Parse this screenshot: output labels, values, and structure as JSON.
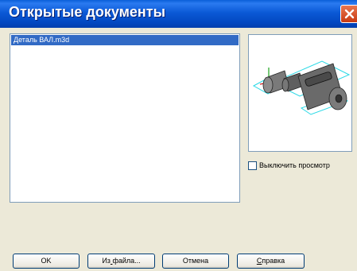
{
  "window": {
    "title": "Открытые документы"
  },
  "documents": {
    "items": [
      {
        "label": "Деталь ВАЛ.m3d",
        "selected": true
      }
    ]
  },
  "preview": {
    "icon": "3d-shaft-part-preview"
  },
  "options": {
    "disable_preview_label": "Выключить просмотр",
    "disable_preview_checked": false
  },
  "buttons": {
    "ok": "OK",
    "from_file_prefix": "Из",
    "from_file_mnemonic": " ",
    "from_file_suffix": "файла...",
    "cancel": "Отмена",
    "help_mnemonic": "С",
    "help_rest": "правка"
  },
  "colors": {
    "titlebar": "#0b59d6",
    "selection": "#316ac5",
    "dialog_bg": "#ece9d8",
    "close_button": "#d6491d"
  }
}
